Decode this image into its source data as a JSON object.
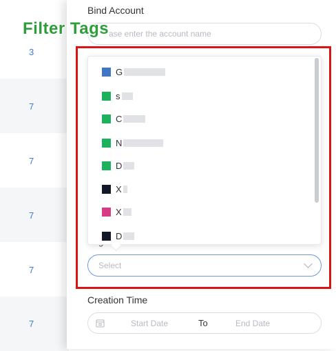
{
  "background_table": {
    "values": [
      "3",
      "7",
      "7",
      "7",
      "7",
      "7"
    ]
  },
  "drawer": {
    "bind_account": {
      "label": "Bind Account",
      "placeholder": "ase enter the account name"
    },
    "tags_select": {
      "partial_label": "g",
      "placeholder": "Select",
      "options": [
        {
          "text": "G",
          "color": "#3f77c4"
        },
        {
          "text": "s",
          "color": "#1db15d"
        },
        {
          "text": "C",
          "color": "#1db15d"
        },
        {
          "text": "N",
          "color": "#1db15d"
        },
        {
          "text": "D",
          "color": "#1db15d"
        },
        {
          "text": "X",
          "color": "#121827"
        },
        {
          "text": "X",
          "color": "#d93a84"
        },
        {
          "text": "D",
          "color": "#121827"
        }
      ]
    },
    "creation_time": {
      "label": "Creation Time",
      "start_placeholder": "Start Date",
      "separator": "To",
      "end_placeholder": "End Date"
    }
  },
  "annotation": {
    "title": "Filter Tags",
    "color": "#2e9e3a",
    "box_color": "#d91515"
  }
}
